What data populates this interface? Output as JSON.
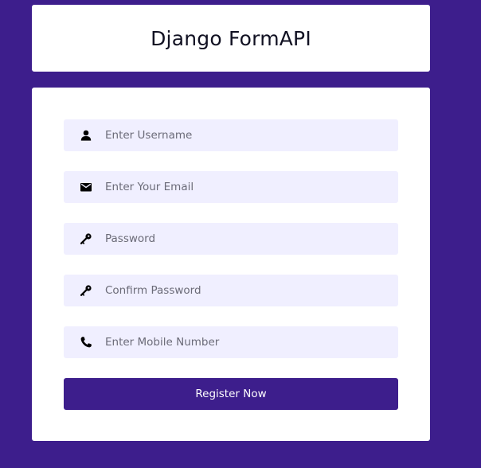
{
  "header": {
    "title": "Django FormAPI"
  },
  "form": {
    "fields": [
      {
        "icon": "user-icon",
        "placeholder": "Enter Username",
        "value": ""
      },
      {
        "icon": "envelope-icon",
        "placeholder": "Enter Your Email",
        "value": ""
      },
      {
        "icon": "key-icon",
        "placeholder": "Password",
        "value": ""
      },
      {
        "icon": "key-icon",
        "placeholder": "Confirm Password",
        "value": ""
      },
      {
        "icon": "phone-icon",
        "placeholder": "Enter Mobile Number",
        "value": ""
      }
    ],
    "submit_label": "Register Now"
  },
  "colors": {
    "background": "#3d1e8c",
    "card": "#ffffff",
    "field_background": "#f0efff",
    "button": "#3d1e8c",
    "button_text": "#ffffff"
  }
}
